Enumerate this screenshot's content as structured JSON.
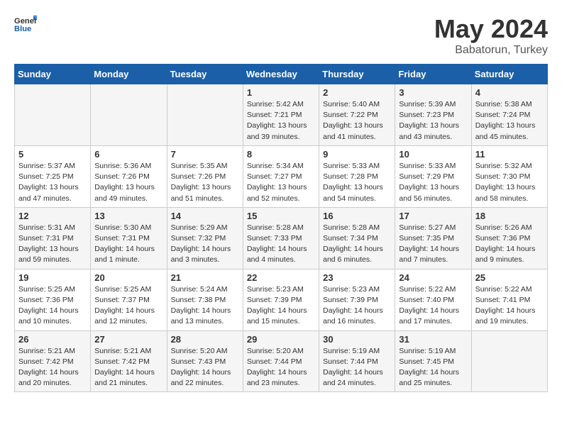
{
  "header": {
    "logo_general": "General",
    "logo_blue": "Blue",
    "title": "May 2024",
    "subtitle": "Babatorun, Turkey"
  },
  "weekdays": [
    "Sunday",
    "Monday",
    "Tuesday",
    "Wednesday",
    "Thursday",
    "Friday",
    "Saturday"
  ],
  "weeks": [
    [
      {
        "day": "",
        "sunrise": "",
        "sunset": "",
        "daylight": ""
      },
      {
        "day": "",
        "sunrise": "",
        "sunset": "",
        "daylight": ""
      },
      {
        "day": "",
        "sunrise": "",
        "sunset": "",
        "daylight": ""
      },
      {
        "day": "1",
        "sunrise": "Sunrise: 5:42 AM",
        "sunset": "Sunset: 7:21 PM",
        "daylight": "Daylight: 13 hours and 39 minutes."
      },
      {
        "day": "2",
        "sunrise": "Sunrise: 5:40 AM",
        "sunset": "Sunset: 7:22 PM",
        "daylight": "Daylight: 13 hours and 41 minutes."
      },
      {
        "day": "3",
        "sunrise": "Sunrise: 5:39 AM",
        "sunset": "Sunset: 7:23 PM",
        "daylight": "Daylight: 13 hours and 43 minutes."
      },
      {
        "day": "4",
        "sunrise": "Sunrise: 5:38 AM",
        "sunset": "Sunset: 7:24 PM",
        "daylight": "Daylight: 13 hours and 45 minutes."
      }
    ],
    [
      {
        "day": "5",
        "sunrise": "Sunrise: 5:37 AM",
        "sunset": "Sunset: 7:25 PM",
        "daylight": "Daylight: 13 hours and 47 minutes."
      },
      {
        "day": "6",
        "sunrise": "Sunrise: 5:36 AM",
        "sunset": "Sunset: 7:26 PM",
        "daylight": "Daylight: 13 hours and 49 minutes."
      },
      {
        "day": "7",
        "sunrise": "Sunrise: 5:35 AM",
        "sunset": "Sunset: 7:26 PM",
        "daylight": "Daylight: 13 hours and 51 minutes."
      },
      {
        "day": "8",
        "sunrise": "Sunrise: 5:34 AM",
        "sunset": "Sunset: 7:27 PM",
        "daylight": "Daylight: 13 hours and 52 minutes."
      },
      {
        "day": "9",
        "sunrise": "Sunrise: 5:33 AM",
        "sunset": "Sunset: 7:28 PM",
        "daylight": "Daylight: 13 hours and 54 minutes."
      },
      {
        "day": "10",
        "sunrise": "Sunrise: 5:33 AM",
        "sunset": "Sunset: 7:29 PM",
        "daylight": "Daylight: 13 hours and 56 minutes."
      },
      {
        "day": "11",
        "sunrise": "Sunrise: 5:32 AM",
        "sunset": "Sunset: 7:30 PM",
        "daylight": "Daylight: 13 hours and 58 minutes."
      }
    ],
    [
      {
        "day": "12",
        "sunrise": "Sunrise: 5:31 AM",
        "sunset": "Sunset: 7:31 PM",
        "daylight": "Daylight: 13 hours and 59 minutes."
      },
      {
        "day": "13",
        "sunrise": "Sunrise: 5:30 AM",
        "sunset": "Sunset: 7:31 PM",
        "daylight": "Daylight: 14 hours and 1 minute."
      },
      {
        "day": "14",
        "sunrise": "Sunrise: 5:29 AM",
        "sunset": "Sunset: 7:32 PM",
        "daylight": "Daylight: 14 hours and 3 minutes."
      },
      {
        "day": "15",
        "sunrise": "Sunrise: 5:28 AM",
        "sunset": "Sunset: 7:33 PM",
        "daylight": "Daylight: 14 hours and 4 minutes."
      },
      {
        "day": "16",
        "sunrise": "Sunrise: 5:28 AM",
        "sunset": "Sunset: 7:34 PM",
        "daylight": "Daylight: 14 hours and 6 minutes."
      },
      {
        "day": "17",
        "sunrise": "Sunrise: 5:27 AM",
        "sunset": "Sunset: 7:35 PM",
        "daylight": "Daylight: 14 hours and 7 minutes."
      },
      {
        "day": "18",
        "sunrise": "Sunrise: 5:26 AM",
        "sunset": "Sunset: 7:36 PM",
        "daylight": "Daylight: 14 hours and 9 minutes."
      }
    ],
    [
      {
        "day": "19",
        "sunrise": "Sunrise: 5:25 AM",
        "sunset": "Sunset: 7:36 PM",
        "daylight": "Daylight: 14 hours and 10 minutes."
      },
      {
        "day": "20",
        "sunrise": "Sunrise: 5:25 AM",
        "sunset": "Sunset: 7:37 PM",
        "daylight": "Daylight: 14 hours and 12 minutes."
      },
      {
        "day": "21",
        "sunrise": "Sunrise: 5:24 AM",
        "sunset": "Sunset: 7:38 PM",
        "daylight": "Daylight: 14 hours and 13 minutes."
      },
      {
        "day": "22",
        "sunrise": "Sunrise: 5:23 AM",
        "sunset": "Sunset: 7:39 PM",
        "daylight": "Daylight: 14 hours and 15 minutes."
      },
      {
        "day": "23",
        "sunrise": "Sunrise: 5:23 AM",
        "sunset": "Sunset: 7:39 PM",
        "daylight": "Daylight: 14 hours and 16 minutes."
      },
      {
        "day": "24",
        "sunrise": "Sunrise: 5:22 AM",
        "sunset": "Sunset: 7:40 PM",
        "daylight": "Daylight: 14 hours and 17 minutes."
      },
      {
        "day": "25",
        "sunrise": "Sunrise: 5:22 AM",
        "sunset": "Sunset: 7:41 PM",
        "daylight": "Daylight: 14 hours and 19 minutes."
      }
    ],
    [
      {
        "day": "26",
        "sunrise": "Sunrise: 5:21 AM",
        "sunset": "Sunset: 7:42 PM",
        "daylight": "Daylight: 14 hours and 20 minutes."
      },
      {
        "day": "27",
        "sunrise": "Sunrise: 5:21 AM",
        "sunset": "Sunset: 7:42 PM",
        "daylight": "Daylight: 14 hours and 21 minutes."
      },
      {
        "day": "28",
        "sunrise": "Sunrise: 5:20 AM",
        "sunset": "Sunset: 7:43 PM",
        "daylight": "Daylight: 14 hours and 22 minutes."
      },
      {
        "day": "29",
        "sunrise": "Sunrise: 5:20 AM",
        "sunset": "Sunset: 7:44 PM",
        "daylight": "Daylight: 14 hours and 23 minutes."
      },
      {
        "day": "30",
        "sunrise": "Sunrise: 5:19 AM",
        "sunset": "Sunset: 7:44 PM",
        "daylight": "Daylight: 14 hours and 24 minutes."
      },
      {
        "day": "31",
        "sunrise": "Sunrise: 5:19 AM",
        "sunset": "Sunset: 7:45 PM",
        "daylight": "Daylight: 14 hours and 25 minutes."
      },
      {
        "day": "",
        "sunrise": "",
        "sunset": "",
        "daylight": ""
      }
    ]
  ]
}
